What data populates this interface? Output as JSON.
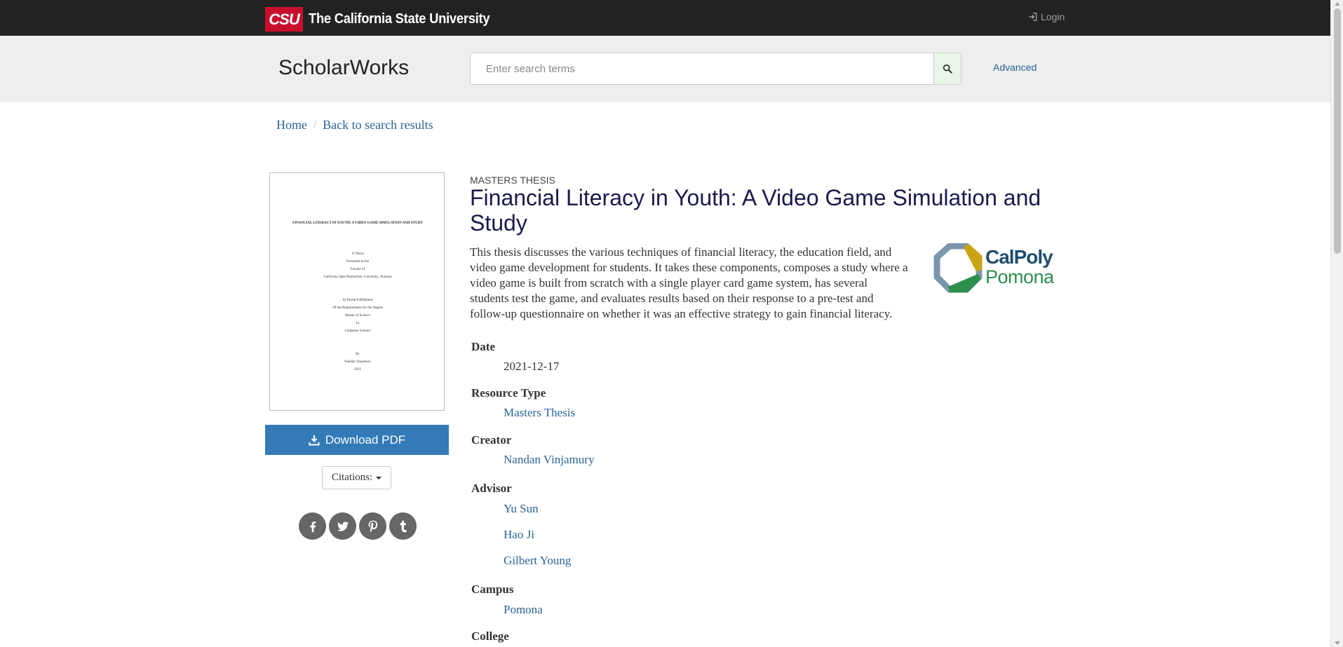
{
  "header": {
    "logo_mark": "CSU",
    "org_name": "The California State University",
    "login_label": "Login"
  },
  "search": {
    "brand": "ScholarWorks",
    "placeholder": "Enter search terms",
    "advanced_label": "Advanced"
  },
  "breadcrumb": {
    "home": "Home",
    "sep": "/",
    "back": "Back to search results"
  },
  "thumbnail": {
    "title": "FINANCIAL LITERACY IN YOUTH: A VIDEO GAME SIMULATION AND STUDY",
    "lines": [
      "A Thesis",
      "Presented to the",
      "Faculty of",
      "California State Polytechnic University, Pomona",
      "",
      "",
      "In Partial Fulfillment",
      "Of the Requirements for the Degree",
      "Master of Science",
      "In",
      "Computer Science",
      "",
      "",
      "By",
      "Nandan Vinjamury",
      "2021"
    ]
  },
  "actions": {
    "download_label": "Download PDF",
    "citations_label": "Citations:"
  },
  "social": [
    "facebook-icon",
    "twitter-icon",
    "pinterest-icon",
    "tumblr-icon"
  ],
  "record": {
    "type": "MASTERS THESIS",
    "title": "Financial Literacy in Youth: A Video Game Simulation and Study",
    "abstract": "This thesis discusses the various techniques of financial literacy, the education field, and video game development for students. It takes these components, composes a study where a video game is built from scratch with a single player card game system, has several students test the game, and evaluates results based on their response to a pre-test and follow-up questionnaire on whether it was an effective strategy to gain financial literacy.",
    "campus_logo": {
      "line1": "CalPoly",
      "line2": "Pomona"
    },
    "fields": {
      "date_label": "Date",
      "date_value": "2021-12-17",
      "resource_label": "Resource Type",
      "resource_value": "Masters Thesis",
      "creator_label": "Creator",
      "creator_value": "Nandan Vinjamury",
      "advisor_label": "Advisor",
      "advisors": [
        "Yu Sun",
        "Hao Ji",
        "Gilbert Young"
      ],
      "campus_label": "Campus",
      "campus_value": "Pomona",
      "college_label": "College"
    }
  },
  "colors": {
    "topbar": "#222222",
    "csu_red": "#c8102e",
    "link": "#2a6496",
    "download_button": "#337ab7",
    "title": "#1a1a4b"
  }
}
